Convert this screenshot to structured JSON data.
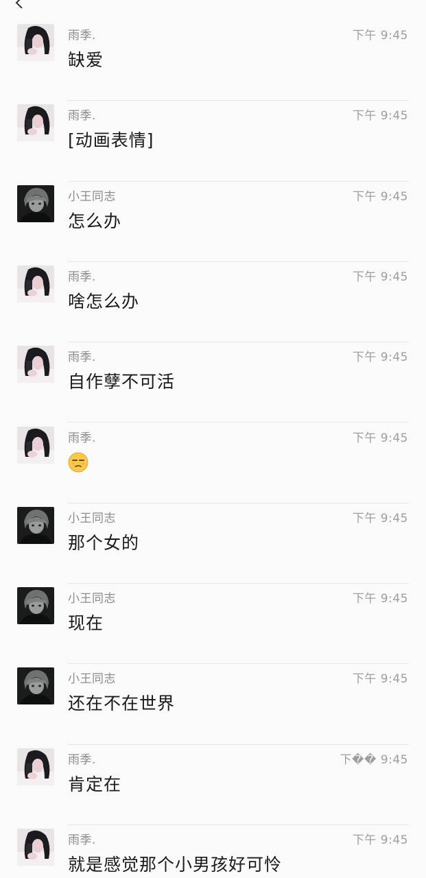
{
  "messages": [
    {
      "sender": "雨季.",
      "avatar": "girl-avatar",
      "time": "下午 9:45",
      "text": "缺爱"
    },
    {
      "sender": "雨季.",
      "avatar": "girl-avatar",
      "time": "下午 9:45",
      "text": "[动画表情]"
    },
    {
      "sender": "小王同志",
      "avatar": "boy-avatar",
      "time": "下午 9:45",
      "text": "怎么办"
    },
    {
      "sender": "雨季.",
      "avatar": "girl-avatar",
      "time": "下午 9:45",
      "text": "啥怎么办"
    },
    {
      "sender": "雨季.",
      "avatar": "girl-avatar",
      "time": "下午 9:45",
      "text": "自作孽不可活"
    },
    {
      "sender": "雨季.",
      "avatar": "girl-avatar",
      "time": "下午 9:45",
      "text": "",
      "emoji": "unamused-face-emoji"
    },
    {
      "sender": "小王同志",
      "avatar": "boy-avatar",
      "time": "下午 9:45",
      "text": "那个女的"
    },
    {
      "sender": "小王同志",
      "avatar": "boy-avatar",
      "time": "下午 9:45",
      "text": "现在"
    },
    {
      "sender": "小王同志",
      "avatar": "boy-avatar",
      "time": "下午 9:45",
      "text": "还在不在世界"
    },
    {
      "sender": "雨季.",
      "avatar": "girl-avatar",
      "time": "下�� 9:45",
      "text": "肯定在"
    },
    {
      "sender": "雨季.",
      "avatar": "girl-avatar",
      "time": "下午 9:45",
      "text": "就是感觉那个小男孩好可怜"
    }
  ],
  "icons": {
    "back": "chevron-left-icon"
  },
  "colors": {
    "background": "#fafafa",
    "sender": "#8b8b8b",
    "time": "#9d9d9d",
    "text": "#1a1a1a",
    "divider": "#e6e6e6"
  }
}
